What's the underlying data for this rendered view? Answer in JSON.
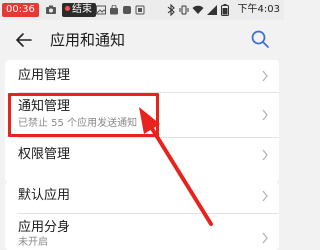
{
  "status_bar": {
    "time_badge": "00:36",
    "recording_label": "结束",
    "clock": "下午4:03"
  },
  "header": {
    "title": "应用和通知"
  },
  "rows": [
    {
      "title": "应用管理"
    },
    {
      "title": "通知管理",
      "subtitle": "已禁止 55 个应用发送通知"
    },
    {
      "title": "权限管理"
    },
    {
      "title": "默认应用"
    },
    {
      "title": "应用分身",
      "subtitle": "未开启"
    }
  ],
  "icons": {
    "back": "back-arrow-icon",
    "search": "search-icon",
    "chevron": "chevron-right-icon",
    "annotation": "red-arrow-annotation"
  },
  "colors": {
    "highlight": "#e8231d",
    "time_badge": "#e53935",
    "accent": "#3a6fd8"
  }
}
